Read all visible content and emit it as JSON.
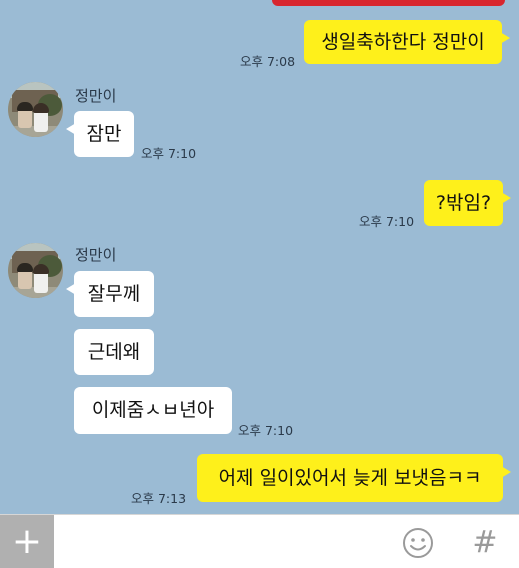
{
  "chat": {
    "messages": [
      {
        "sender": "me",
        "text": "생일축하한다 정만이",
        "time": "오후 7:08"
      },
      {
        "sender": "정만이",
        "text": "잠만",
        "time": "오후 7:10"
      },
      {
        "sender": "me",
        "text": "?밖임?",
        "time": "오후 7:10"
      },
      {
        "sender": "정만이",
        "text": "잘무께"
      },
      {
        "sender": "정만이",
        "text": "근데왜"
      },
      {
        "sender": "정만이",
        "text": "이제줌ㅅㅂ년아",
        "time": "오후 7:10"
      },
      {
        "sender": "me",
        "text": "어제 일이있어서 늦게 보냇음ㅋㅋ",
        "time": "오후 7:13"
      }
    ]
  },
  "contact": {
    "name": "정만이"
  },
  "input_bar": {
    "plus_icon": "plus-icon",
    "emoji_icon": "smiley-icon",
    "hash_icon": "hash-icon",
    "plus_glyph": "+",
    "hash_glyph": "#"
  },
  "colors": {
    "background": "#9bbbd4",
    "my_bubble": "#fef01b",
    "their_bubble": "#ffffff",
    "accent_red": "#d8262e"
  }
}
